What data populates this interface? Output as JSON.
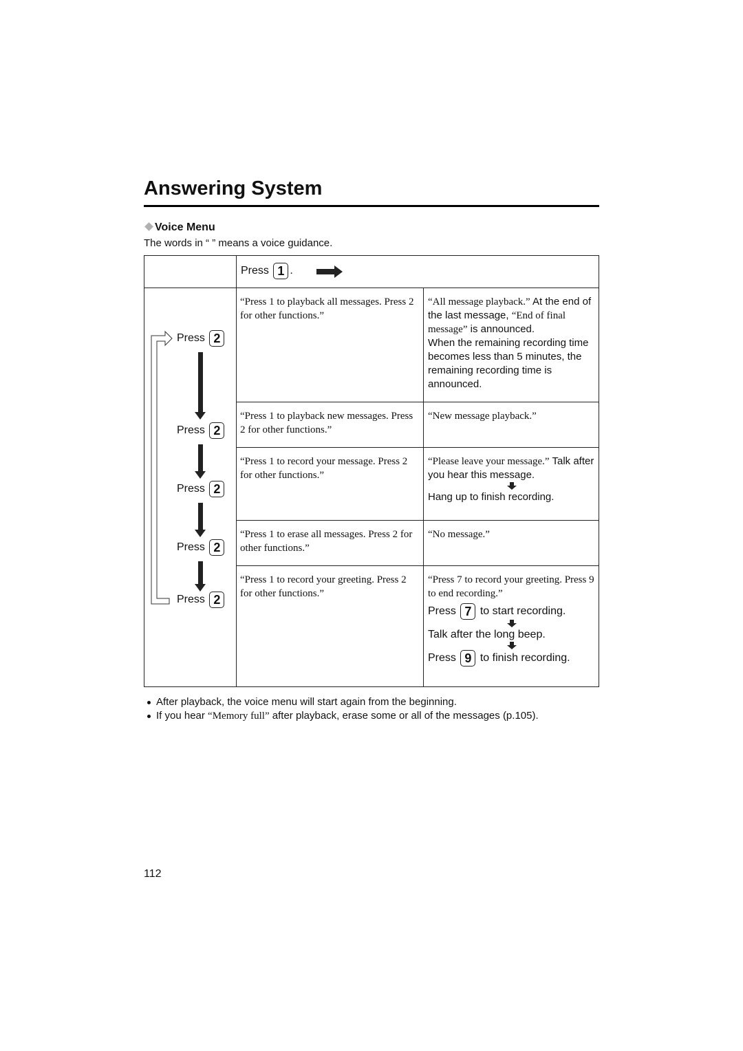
{
  "page": {
    "title": "Answering System",
    "section_title": "Voice Menu",
    "intro": "The words in “ ” means a voice guidance.",
    "page_number": "112"
  },
  "table": {
    "header": {
      "press": "Press",
      "key": "1",
      "suffix": "."
    },
    "press_label": "Press",
    "step_key": "2",
    "rows": [
      {
        "guidance": "“Press 1 to playback all messages. Press 2 for other functions.”",
        "result_voice": "“All message playback.”",
        "result_text_1": " At the end of the last message, ",
        "result_voice_2": "“End of final message”",
        "result_text_2": " is announced.",
        "result_text_3": "When the remaining recording time becomes less than 5 minutes, the remaining recording time is announced."
      },
      {
        "guidance": "“Press 1 to playback new messages. Press 2 for other functions.”",
        "result_voice": "“New message playback.”"
      },
      {
        "guidance": "“Press 1 to record your message. Press 2 for other functions.”",
        "result_voice": "“Please leave your message.”",
        "result_text_1": " Talk after you hear this message.",
        "result_text_2": "Hang up to finish recording."
      },
      {
        "guidance": "“Press 1 to erase all messages. Press 2 for other functions.”",
        "result_voice": "“No message.”"
      },
      {
        "guidance": "“Press 1 to record your greeting. Press 2 for other functions.”",
        "result_voice": "“Press 7 to record your greeting. Press 9 to end recording.”",
        "step1_press": "Press",
        "step1_key": "7",
        "step1_text": "to start recording.",
        "step2_text": "Talk after the long beep.",
        "step3_press": "Press",
        "step3_key": "9",
        "step3_text": "to finish recording."
      }
    ]
  },
  "notes": [
    {
      "text": "After playback, the voice menu will start again from the beginning."
    },
    {
      "pre": "If you hear ",
      "voice": "“Memory full”",
      "post": " after playback, erase some or all of the messages (p.105)."
    }
  ]
}
